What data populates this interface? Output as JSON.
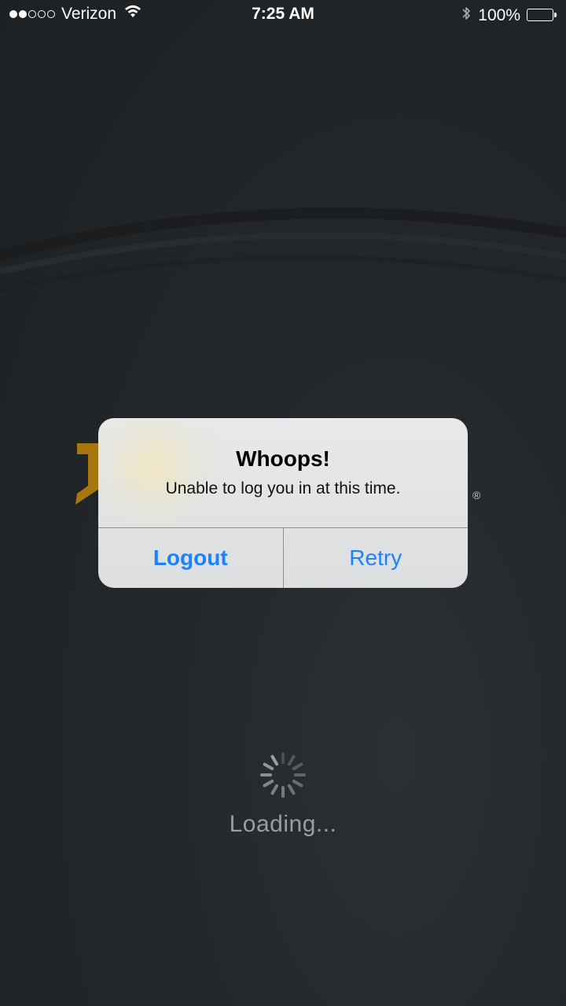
{
  "status_bar": {
    "carrier": "Verizon",
    "time": "7:25 AM",
    "battery_percent": "100%",
    "signal_bars_filled": 2,
    "signal_bars_total": 5
  },
  "background": {
    "registered_mark": "®"
  },
  "alert": {
    "title": "Whoops!",
    "message": "Unable to log you in at this time.",
    "buttons": [
      {
        "label": "Logout"
      },
      {
        "label": "Retry"
      }
    ]
  },
  "loading": {
    "text": "Loading..."
  },
  "colors": {
    "accent": "#1a82fb",
    "brand_gold": "#a8760e"
  }
}
